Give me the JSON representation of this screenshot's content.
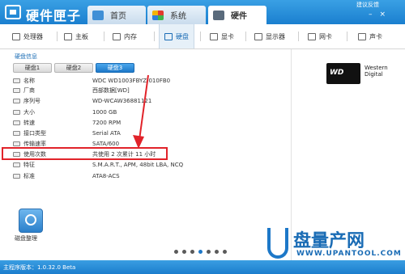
{
  "app": {
    "title": "硬件匣子",
    "feedback": "建议反馈"
  },
  "tabs": [
    {
      "label": "首页"
    },
    {
      "label": "系统"
    },
    {
      "label": "硬件"
    }
  ],
  "subnav": [
    {
      "label": "处理器",
      "icon": "cpu-icon"
    },
    {
      "label": "主板",
      "icon": "motherboard-icon"
    },
    {
      "label": "内存",
      "icon": "memory-icon"
    },
    {
      "label": "硬盘",
      "icon": "harddisk-icon"
    },
    {
      "label": "显卡",
      "icon": "gpu-icon"
    },
    {
      "label": "显示器",
      "icon": "monitor-icon"
    },
    {
      "label": "网卡",
      "icon": "network-icon"
    },
    {
      "label": "声卡",
      "icon": "sound-icon"
    }
  ],
  "disk": {
    "section_title": "硬盘信息",
    "tabs": [
      {
        "label": "硬盘1"
      },
      {
        "label": "硬盘2"
      },
      {
        "label": "硬盘3"
      }
    ],
    "rows": [
      {
        "label": "名称",
        "value": "WDC WD1003FBYZ-010FB0"
      },
      {
        "label": "厂商",
        "value": "西部数据[WD]"
      },
      {
        "label": "序列号",
        "value": "WD-WCAW36881121"
      },
      {
        "label": "大小",
        "value": "1000 GB"
      },
      {
        "label": "转速",
        "value": "7200 RPM"
      },
      {
        "label": "接口类型",
        "value": "Serial ATA"
      },
      {
        "label": "传输速率",
        "value": "SATA/600"
      },
      {
        "label": "使用次数",
        "value": "共使用 2 次累计 11 小时"
      },
      {
        "label": "特征",
        "value": "S.M.A.R.T., APM, 48bit LBA, NCQ"
      },
      {
        "label": "标准",
        "value": "ATA8-ACS"
      }
    ]
  },
  "tool": {
    "label": "磁盘整理"
  },
  "brand": {
    "line1": "Western",
    "line2": "Digital"
  },
  "status": {
    "version": "主程序版本：1.0.32.0 Beta"
  },
  "watermark": {
    "text": "盘量产网",
    "url": "WWW.UPANTOOL.COM"
  },
  "colors": {
    "accent": "#1d78c8",
    "highlight": "#e1232a"
  }
}
